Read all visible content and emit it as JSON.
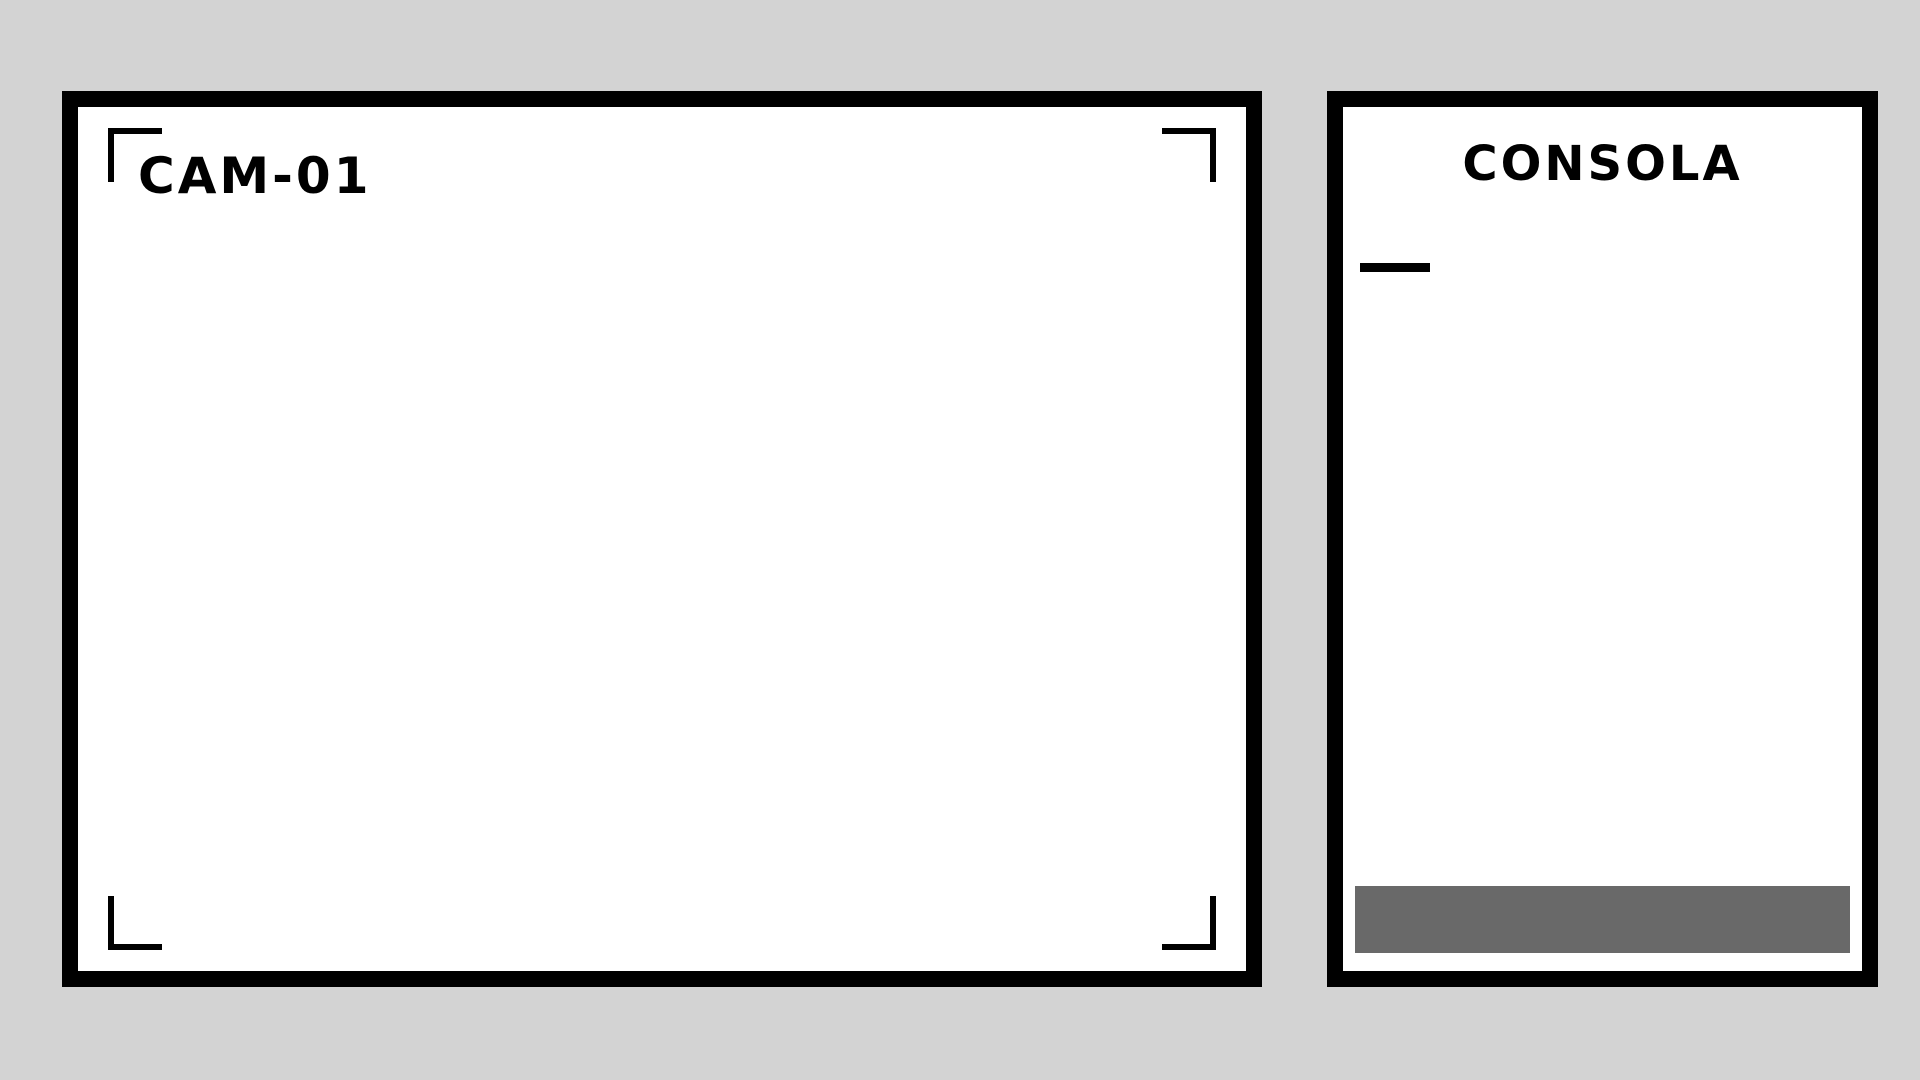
{
  "camera": {
    "label": "CAM-01"
  },
  "console": {
    "title": "CONSOLA",
    "output": "",
    "input_value": ""
  },
  "colors": {
    "background": "#d3d3d3",
    "panel_border": "#000000",
    "panel_fill": "#ffffff",
    "input_bar": "#696969"
  }
}
